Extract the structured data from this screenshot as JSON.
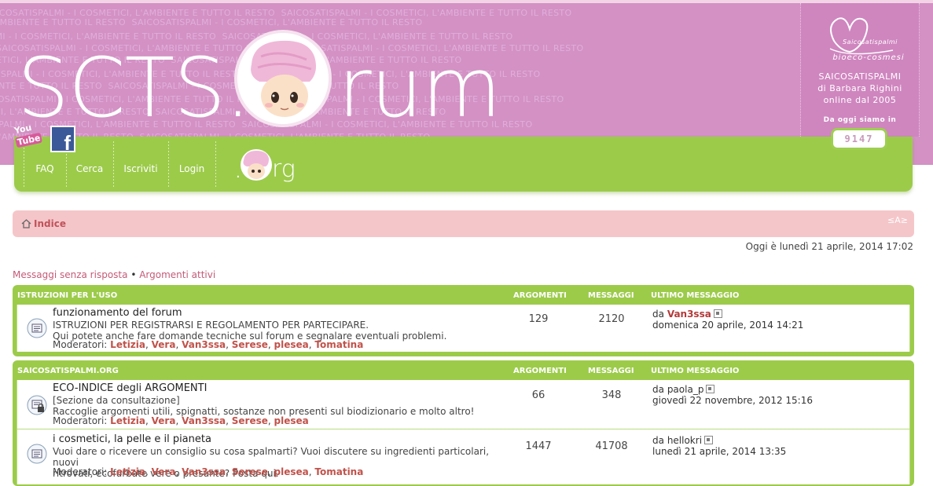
{
  "header": {
    "watermark": "SAICOSATISPALMI - I COSMETICI, L'AMBIENTE E TUTTO IL RESTO",
    "logo_left": "SCTS.F",
    "logo_right": "rum",
    "org_text": "rg",
    "brand": {
      "name": "SAICOSATISPALMI",
      "author": "di Barbara Righini",
      "since": "online dal 2005",
      "counter_label": "Da oggi siamo in",
      "counter_value": "9147",
      "logo_line1": "Saicosatispalmi",
      "logo_line2": "bioeco-cosmesi"
    },
    "social": {
      "youtube_line1": "You",
      "youtube_line2": "Tube"
    },
    "nav": [
      "FAQ",
      "Cerca",
      "Iscriviti",
      "Login"
    ]
  },
  "breadcrumb": {
    "home_label": "Indice",
    "font_size_control": "≤A≥"
  },
  "current_date": "Oggi è lunedì 21 aprile, 2014 17:02",
  "quick_links": {
    "unanswered": "Messaggi senza risposta",
    "separator": "•",
    "active": "Argomenti attivi"
  },
  "colors": {
    "pink": "#d391c4",
    "green": "#9ccb4a",
    "crumb": "#f5c6c9",
    "accent_red": "#c0524a"
  },
  "categories": [
    {
      "name": "ISTRUZIONI PER L'USO",
      "col_topics": "ARGOMENTI",
      "col_posts": "MESSAGGI",
      "col_last": "ULTIMO MESSAGGIO",
      "forums": [
        {
          "icon": "forum-read-icon",
          "title": "funzionamento del forum",
          "desc1": "ISTRUZIONI PER REGISTRARSI E REGOLAMENTO PER PARTECIPARE.",
          "desc2": "Qui potete anche fare domande tecniche sul forum e segnalare eventuali problemi.",
          "mods_label": "Moderatori:",
          "mods": [
            "Letizia",
            "Vera",
            "Van3ssa",
            "Serese",
            "plesea",
            "Tomatina"
          ],
          "topics": "129",
          "posts": "2120",
          "last_by": "da",
          "last_user": "Van3ssa",
          "last_date": "domenica 20 aprile, 2014 14:21"
        }
      ]
    },
    {
      "name": "SAICOSATISPALMI.ORG",
      "col_topics": "ARGOMENTI",
      "col_posts": "MESSAGGI",
      "col_last": "ULTIMO MESSAGGIO",
      "forums": [
        {
          "icon": "forum-locked-icon",
          "title": "ECO-INDICE degli ARGOMENTI",
          "desc1": "[Sezione da consultazione]",
          "desc2": "Raccoglie argomenti utili, spignatti, sostanze non presenti sul biodizionario e molto altro!",
          "mods_label": "Moderatori:",
          "mods": [
            "Letizia",
            "Vera",
            "Van3ssa",
            "Serese",
            "plesea"
          ],
          "topics": "66",
          "posts": "348",
          "last_by": "da",
          "last_user": "paola_p",
          "last_date": "giovedì 22 novembre, 2012 15:16"
        },
        {
          "icon": "forum-read-icon",
          "title": "i cosmetici, la pelle e il pianeta",
          "desc1": "Vuoi dare o ricevere un consiglio su cosa spalmarti? Vuoi discutere su ingredienti particolari, nuovi",
          "desc2": "ritrovati, ecofurbate vere o presunte? Posta qui.",
          "mods_label": "Moderatori:",
          "mods": [
            "Letizia",
            "Vera",
            "Van3ssa",
            "Serese",
            "plesea",
            "Tomatina"
          ],
          "topics": "1447",
          "posts": "41708",
          "last_by": "da",
          "last_user": "hellokri",
          "last_date": "lunedì 21 aprile, 2014 13:35"
        }
      ]
    }
  ]
}
